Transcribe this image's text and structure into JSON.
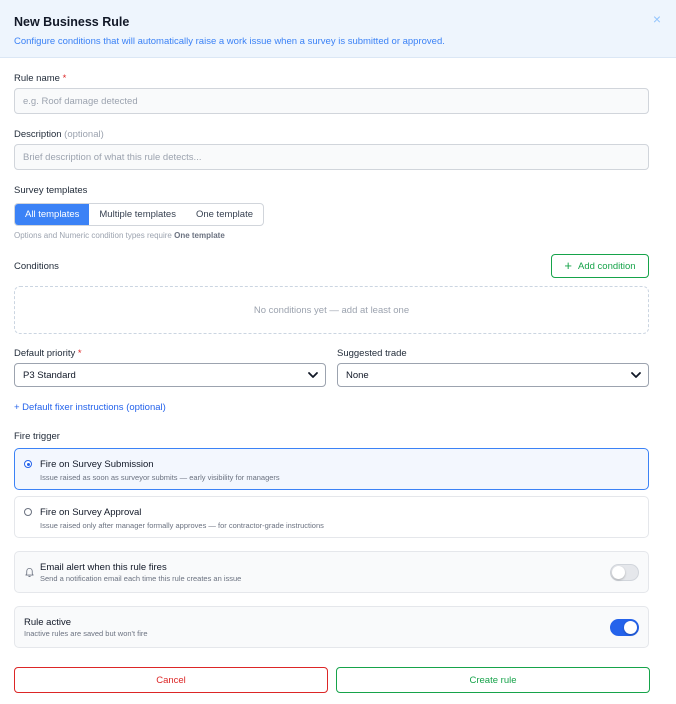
{
  "header": {
    "title": "New Business Rule",
    "subtitle": "Configure conditions that will automatically raise a work issue when a survey is submitted or approved.",
    "close_icon": "×"
  },
  "rule_name": {
    "label": "Rule name",
    "required_mark": "*",
    "placeholder": "e.g. Roof damage detected",
    "value": ""
  },
  "description": {
    "label": "Description",
    "optional_mark": "(optional)",
    "placeholder": "Brief description of what this rule detects...",
    "value": ""
  },
  "survey_templates": {
    "label": "Survey templates",
    "options": [
      "All templates",
      "Multiple templates",
      "One template"
    ],
    "selected": "All templates",
    "hint_prefix": "Options and Numeric condition types require",
    "hint_emph": "One template"
  },
  "conditions": {
    "label": "Conditions",
    "add_button": "Add condition",
    "empty_text": "No conditions yet — add at least one"
  },
  "default_priority": {
    "label": "Default priority",
    "required_mark": "*",
    "value": "P3 Standard"
  },
  "suggested_trade": {
    "label": "Suggested trade",
    "value": "None"
  },
  "fixer_link": "+ Default fixer instructions (optional)",
  "fire_trigger": {
    "label": "Fire trigger",
    "options": [
      {
        "title": "Fire on Survey Submission",
        "subtitle": "Issue raised as soon as surveyor submits — early visibility for managers",
        "selected": true
      },
      {
        "title": "Fire on Survey Approval",
        "subtitle": "Issue raised only after manager formally approves — for contractor-grade instructions",
        "selected": false
      }
    ]
  },
  "email_alert": {
    "title": "Email alert when this rule fires",
    "subtitle": "Send a notification email each time this rule creates an issue",
    "enabled": false
  },
  "rule_active": {
    "title": "Rule active",
    "subtitle": "Inactive rules are saved but won't fire",
    "enabled": true
  },
  "footer": {
    "cancel": "Cancel",
    "create": "Create rule"
  },
  "colors": {
    "accent": "#3b82f6",
    "success": "#16a34a",
    "danger": "#dc2626",
    "header_bg": "#eef5fd"
  }
}
